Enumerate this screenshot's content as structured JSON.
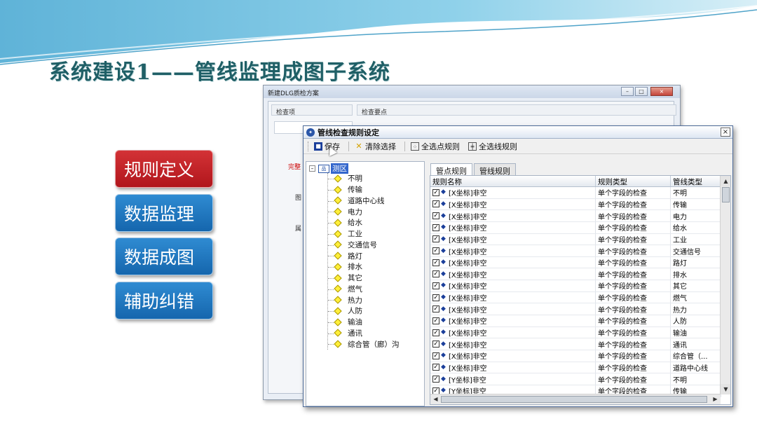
{
  "slide": {
    "title": "系统建设1——管线监理成图子系统",
    "nav": [
      "规则定义",
      "数据监理",
      "数据成图",
      "辅助纠错"
    ],
    "colors": {
      "active": "#c61f24",
      "inactive": "#1e74bf",
      "title": "#1f5f66"
    }
  },
  "back_window": {
    "title": "新建DLG质检方案",
    "left_header": "检查项",
    "right_header": "检查要点",
    "side_labels": [
      "完整",
      "图",
      "属"
    ]
  },
  "dialog": {
    "title": "管线检查规则设定",
    "close": "×",
    "toolbar": {
      "save": "保存",
      "clear": "清除选择",
      "select_points": "全选点规则",
      "select_lines": "全选线规则"
    },
    "tree": {
      "root": "测区",
      "items": [
        "不明",
        "传输",
        "道路中心线",
        "电力",
        "给水",
        "工业",
        "交通信号",
        "路灯",
        "排水",
        "其它",
        "燃气",
        "热力",
        "人防",
        "输油",
        "通讯",
        "综合管（廊）沟"
      ]
    },
    "tabs": [
      "管点规则",
      "管线规则"
    ],
    "active_tab": 0,
    "grid": {
      "headers": [
        "规则名称",
        "规则类型",
        "管线类型"
      ],
      "rows": [
        [
          "[X坐标]非空",
          "单个字段的检查",
          "不明"
        ],
        [
          "[X坐标]非空",
          "单个字段的检查",
          "传输"
        ],
        [
          "[X坐标]非空",
          "单个字段的检查",
          "电力"
        ],
        [
          "[X坐标]非空",
          "单个字段的检查",
          "给水"
        ],
        [
          "[X坐标]非空",
          "单个字段的检查",
          "工业"
        ],
        [
          "[X坐标]非空",
          "单个字段的检查",
          "交通信号"
        ],
        [
          "[X坐标]非空",
          "单个字段的检查",
          "路灯"
        ],
        [
          "[X坐标]非空",
          "单个字段的检查",
          "排水"
        ],
        [
          "[X坐标]非空",
          "单个字段的检查",
          "其它"
        ],
        [
          "[X坐标]非空",
          "单个字段的检查",
          "燃气"
        ],
        [
          "[X坐标]非空",
          "单个字段的检查",
          "热力"
        ],
        [
          "[X坐标]非空",
          "单个字段的检查",
          "人防"
        ],
        [
          "[X坐标]非空",
          "单个字段的检查",
          "输油"
        ],
        [
          "[X坐标]非空",
          "单个字段的检查",
          "通讯"
        ],
        [
          "[X坐标]非空",
          "单个字段的检查",
          "综合管（..."
        ],
        [
          "[X坐标]非空",
          "单个字段的检查",
          "道路中心线"
        ],
        [
          "[Y坐标]非空",
          "单个字段的检查",
          "不明"
        ],
        [
          "[Y坐标]非空",
          "单个字段的检查",
          "传输"
        ]
      ]
    }
  }
}
